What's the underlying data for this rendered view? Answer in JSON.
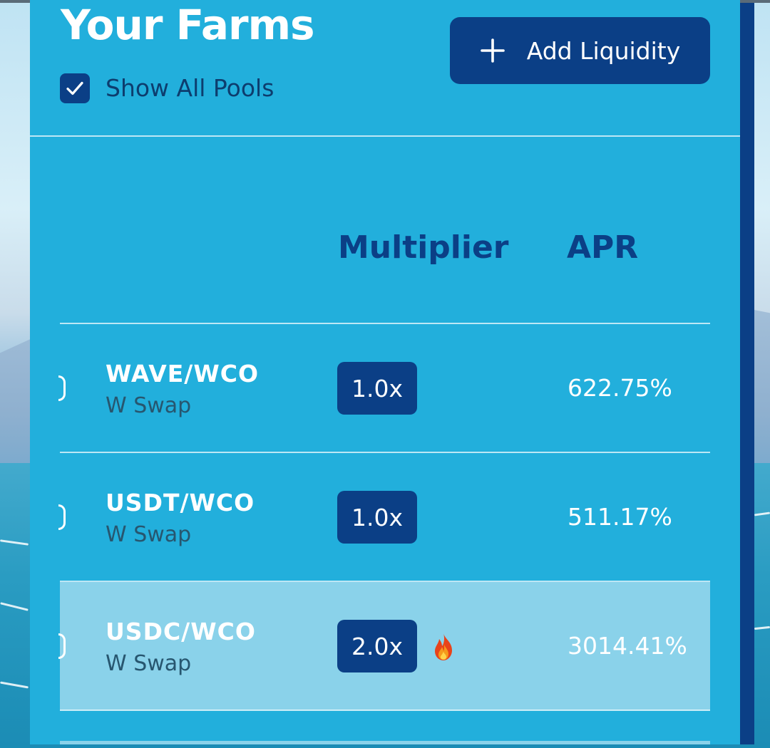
{
  "header": {
    "title": "Your Farms",
    "show_all_label": "Show All Pools",
    "show_all_checked": true,
    "add_liquidity_label": "Add Liquidity"
  },
  "table": {
    "columns": [
      "Multiplier",
      "APR"
    ],
    "rows": [
      {
        "pair": "WAVE/WCO",
        "source": "W Swap",
        "multiplier": "1.0x",
        "apr": "622.75%",
        "hot": false
      },
      {
        "pair": "USDT/WCO",
        "source": "W Swap",
        "multiplier": "1.0x",
        "apr": "511.17%",
        "hot": false
      },
      {
        "pair": "USDC/WCO",
        "source": "W Swap",
        "multiplier": "2.0x",
        "apr": "3014.41%",
        "hot": true
      }
    ]
  },
  "icons": [
    "checkmark-icon",
    "plus-icon",
    "fire-icon"
  ],
  "colors": {
    "panel": "#22afdc",
    "accent": "#0b3f86",
    "highlight_row": "#8ad2ea",
    "text_white": "#ffffff"
  }
}
